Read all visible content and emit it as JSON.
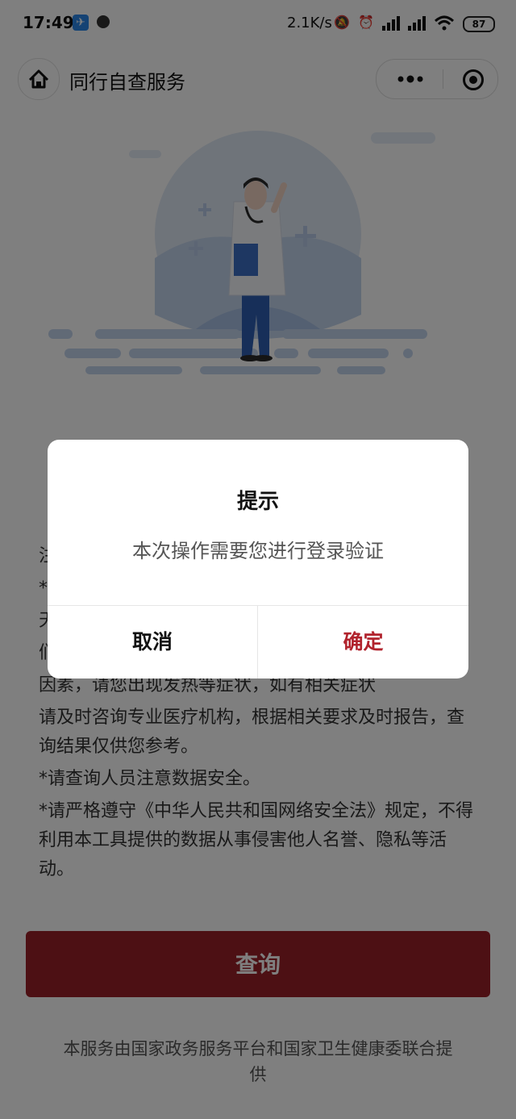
{
  "status_bar": {
    "time": "17:49",
    "network_speed": "2.1K/s",
    "battery": "87",
    "icons": [
      "app-shortcut-icon",
      "dnd-icon",
      "mute-icon",
      "alarm-icon",
      "signal-icon",
      "hd-signal-icon",
      "wifi-icon",
      "battery-icon"
    ]
  },
  "nav": {
    "title": "同行自查服务",
    "home_icon": "home-icon",
    "more_icon": "more-dots-icon",
    "close_icon": "target-close-icon"
  },
  "notes": [
    "注",
    "*",
    "天",
    "们",
    "因素，请您出现发热等症状，如有相关症状",
    "请及时咨询专业医疗机构，根据相关要求及时报告，查询结果仅供您参考。",
    "*请查询人员注意数据安全。",
    "*请严格遵守《中华人民共和国网络安全法》规定，不得利用本工具提供的数据从事侵害他人名誉、隐私等活动。"
  ],
  "query_button": "查询",
  "footer": "本服务由国家政务服务平台和国家卫生健康委联合提供",
  "dialog": {
    "title": "提示",
    "message": "本次操作需要您进行登录验证",
    "cancel": "取消",
    "confirm": "确定"
  },
  "colors": {
    "brand": "#9b2128",
    "confirm_text": "#b1232d",
    "overlay": "rgba(0,0,0,0.5)"
  }
}
